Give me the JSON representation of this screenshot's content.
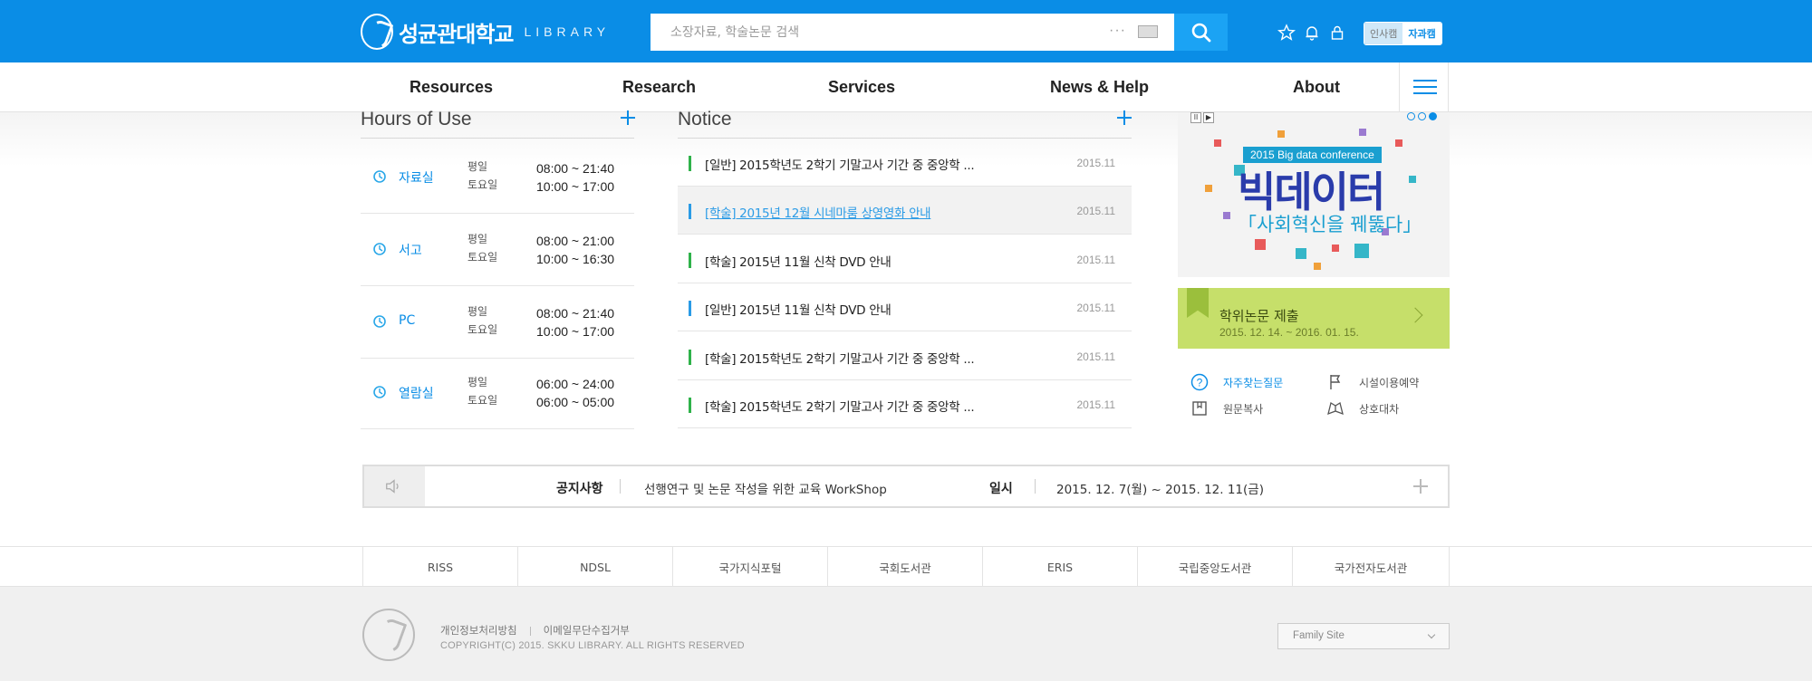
{
  "header": {
    "logo_name": "성균관대학교",
    "logo_sub": "LIBRARY",
    "search_placeholder": "소장자료, 학술논문 검색",
    "campus_humanities": "인사캠",
    "campus_science": "자과캠"
  },
  "nav": {
    "items": [
      "Resources",
      "Research",
      "Services",
      "News & Help",
      "About"
    ]
  },
  "hours": {
    "title": "Hours of Use",
    "rows": [
      {
        "name": "자료실",
        "day1": "평일",
        "day2": "토요일",
        "time1": "08:00 ~ 21:40",
        "time2": "10:00 ~ 17:00"
      },
      {
        "name": "서고",
        "day1": "평일",
        "day2": "토요일",
        "time1": "08:00 ~ 21:00",
        "time2": "10:00 ~ 16:30"
      },
      {
        "name": "PC",
        "day1": "평일",
        "day2": "토요일",
        "time1": "08:00 ~ 21:40",
        "time2": "10:00 ~ 17:00"
      },
      {
        "name": "열람실",
        "day1": "평일",
        "day2": "토요일",
        "time1": "06:00 ~ 24:00",
        "time2": "06:00 ~ 05:00"
      }
    ]
  },
  "notice": {
    "title": "Notice",
    "items": [
      {
        "title": "[일반] 2015학년도 2학기 기말고사 기간 중 중앙학 ...",
        "date": "2015.11",
        "color": "#2fb24a"
      },
      {
        "title": "[학술] 2015년 12월 시네마룸 상영영화 안내",
        "date": "2015.11",
        "color": "#2a9be6"
      },
      {
        "title": "[학술] 2015년 11월 신착 DVD 안내",
        "date": "2015.11",
        "color": "#2fb24a"
      },
      {
        "title": "[일반] 2015년 11월 신착 DVD 안내",
        "date": "2015.11",
        "color": "#2a9be6"
      },
      {
        "title": "[학술] 2015학년도 2학기 기말고사 기간 중 중앙학 ...",
        "date": "2015.11",
        "color": "#2fb24a"
      },
      {
        "title": "[학술] 2015학년도 2학기 기말고사 기간 중 중앙학 ...",
        "date": "2015.11",
        "color": "#2fb24a"
      }
    ]
  },
  "banner": {
    "conference": "2015 Big data conference",
    "headline": "빅데이터",
    "subline": "「사회혁신을 꿰뚫다」"
  },
  "thesis": {
    "title": "학위논문 제출",
    "period": "2015. 12. 14. ~ 2016. 01. 15."
  },
  "quick_links": {
    "faq": "자주찾는질문",
    "facility": "시설이용예약",
    "copy": "원문복사",
    "loan": "상호대차"
  },
  "strip": {
    "label": "공지사항",
    "text": "선행연구 및 논문 작성을 위한 교육 WorkShop",
    "date_label": "일시",
    "date": "2015. 12. 7(월) ~ 2015. 12. 11(금)"
  },
  "links": [
    "RISS",
    "NDSL",
    "국가지식포털",
    "국회도서관",
    "ERIS",
    "국립중앙도서관",
    "국가전자도서관"
  ],
  "footer": {
    "privacy": "개인정보처리방침",
    "email": "이메일무단수집거부",
    "copyright": "COPYRIGHT(C) 2015.  SKKU LIBRARY.  ALL RIGHTS RESERVED",
    "family_site": "Family Site"
  },
  "colors": {
    "brand": "#0a8de6",
    "thesis": "#c6df6a",
    "banner_headline": "#2a3cab"
  }
}
